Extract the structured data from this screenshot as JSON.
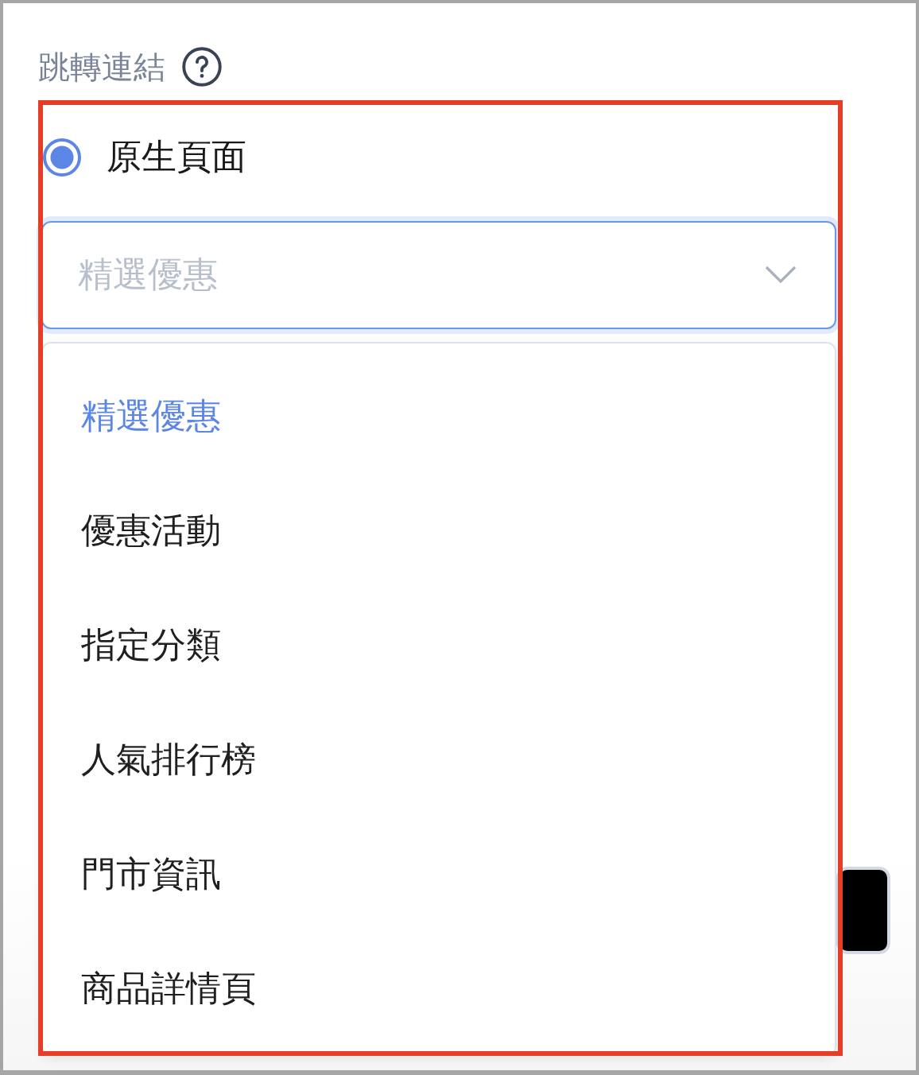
{
  "field": {
    "label": "跳轉連結"
  },
  "radio": {
    "label": "原生頁面",
    "selected": true
  },
  "select": {
    "placeholder": "精選優惠",
    "expanded": true
  },
  "options": [
    {
      "label": "精選優惠",
      "selected": true
    },
    {
      "label": "優惠活動",
      "selected": false
    },
    {
      "label": "指定分類",
      "selected": false
    },
    {
      "label": "人氣排行榜",
      "selected": false
    },
    {
      "label": "門市資訊",
      "selected": false
    },
    {
      "label": "商品詳情頁",
      "selected": false
    }
  ]
}
